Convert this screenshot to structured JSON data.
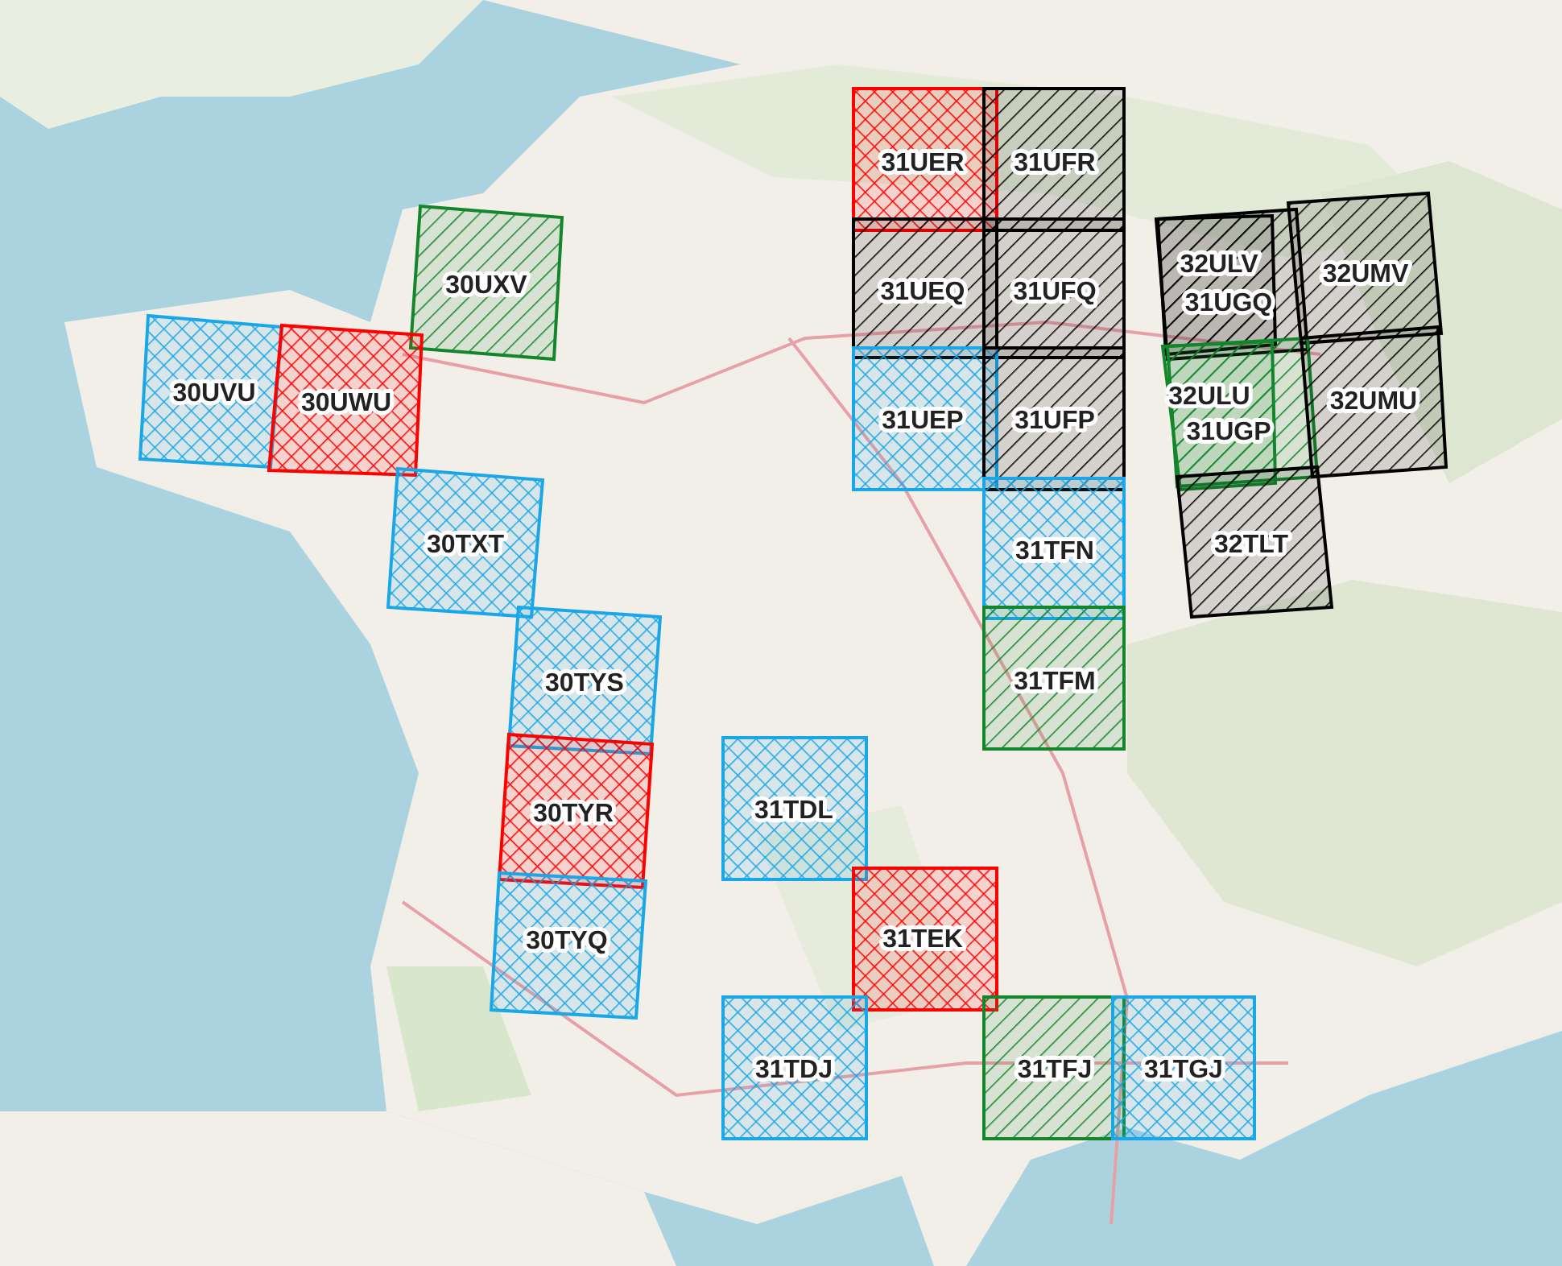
{
  "map": {
    "tiles": [
      {
        "label": "31UER",
        "color": "#ff0000",
        "kind": "cross"
      },
      {
        "label": "31UFR",
        "color": "#000000",
        "kind": "diagonal"
      },
      {
        "label": "30UXV",
        "color": "#13862c",
        "kind": "diagonal"
      },
      {
        "label": "31UEQ",
        "color": "#000000",
        "kind": "diagonal"
      },
      {
        "label": "31UFQ",
        "color": "#000000",
        "kind": "diagonal"
      },
      {
        "label": "32ULV",
        "color": "#000000",
        "kind": "diagonal"
      },
      {
        "label": "31UGQ",
        "color": "#000000",
        "kind": "diagonal"
      },
      {
        "label": "32UMV",
        "color": "#000000",
        "kind": "diagonal"
      },
      {
        "label": "30UVU",
        "color": "#1aa7e8",
        "kind": "cross"
      },
      {
        "label": "30UWU",
        "color": "#ff0000",
        "kind": "cross"
      },
      {
        "label": "31UEP",
        "color": "#1aa7e8",
        "kind": "cross"
      },
      {
        "label": "31UFP",
        "color": "#000000",
        "kind": "diagonal"
      },
      {
        "label": "32ULU",
        "color": "#13862c",
        "kind": "diagonal"
      },
      {
        "label": "31UGP",
        "color": "#13862c",
        "kind": "diagonal"
      },
      {
        "label": "32UMU",
        "color": "#000000",
        "kind": "diagonal"
      },
      {
        "label": "30TXT",
        "color": "#1aa7e8",
        "kind": "cross"
      },
      {
        "label": "31TFN",
        "color": "#1aa7e8",
        "kind": "cross"
      },
      {
        "label": "32TLT",
        "color": "#000000",
        "kind": "diagonal"
      },
      {
        "label": "30TYS",
        "color": "#1aa7e8",
        "kind": "cross"
      },
      {
        "label": "31TFM",
        "color": "#13862c",
        "kind": "diagonal"
      },
      {
        "label": "30TYR",
        "color": "#ff0000",
        "kind": "cross"
      },
      {
        "label": "31TDL",
        "color": "#1aa7e8",
        "kind": "cross"
      },
      {
        "label": "30TYQ",
        "color": "#1aa7e8",
        "kind": "cross"
      },
      {
        "label": "31TEK",
        "color": "#ff0000",
        "kind": "cross"
      },
      {
        "label": "31TDJ",
        "color": "#1aa7e8",
        "kind": "cross"
      },
      {
        "label": "31TFJ",
        "color": "#13862c",
        "kind": "diagonal"
      },
      {
        "label": "31TGJ",
        "color": "#1aa7e8",
        "kind": "cross"
      }
    ]
  }
}
